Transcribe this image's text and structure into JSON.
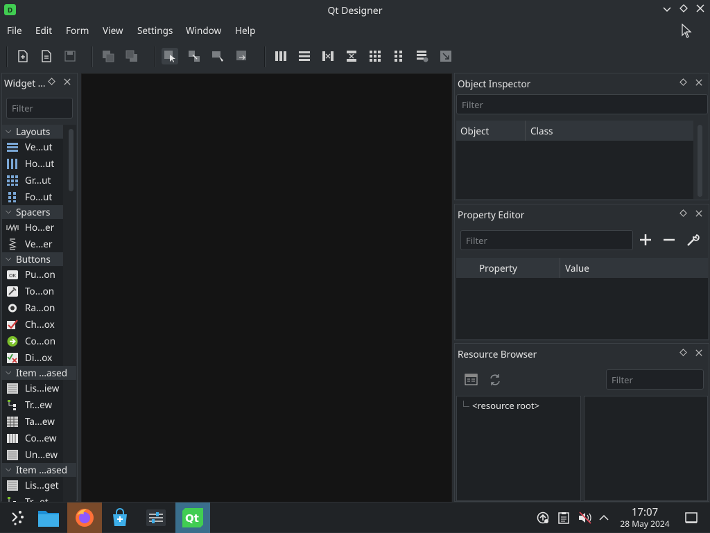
{
  "window": {
    "title": "Qt Designer",
    "icon_letter": "D"
  },
  "menubar": [
    "File",
    "Edit",
    "Form",
    "View",
    "Settings",
    "Window",
    "Help"
  ],
  "widget_box": {
    "title": "Widget ...",
    "filter_placeholder": "Filter",
    "categories": [
      {
        "name": "Layouts",
        "items": [
          "Ve...ut",
          "Ho...ut",
          "Gr...ut",
          "Fo...ut"
        ]
      },
      {
        "name": "Spacers",
        "items": [
          "Ho...er",
          "Ve...er"
        ]
      },
      {
        "name": "Buttons",
        "items": [
          "Pu...on",
          "To...on",
          "Ra...on",
          "Ch...ox",
          "Co...on",
          "Di...ox"
        ]
      },
      {
        "name": "Item ...ased",
        "items": [
          "Lis...iew",
          "Tr...ew",
          "Ta...ew",
          "Co...ew",
          "Un...ew"
        ]
      },
      {
        "name": "Item ...ased",
        "items": [
          "Lis...get",
          "Tr...et"
        ]
      }
    ]
  },
  "object_inspector": {
    "title": "Object Inspector",
    "filter_placeholder": "Filter",
    "columns": [
      "Object",
      "Class"
    ]
  },
  "property_editor": {
    "title": "Property Editor",
    "filter_placeholder": "Filter",
    "columns": [
      "Property",
      "Value"
    ]
  },
  "resource_browser": {
    "title": "Resource Browser",
    "filter_placeholder": "Filter",
    "root": "<resource root>"
  },
  "taskbar": {
    "time": "17:07",
    "date": "28 May 2024"
  },
  "colors": {
    "accent": "#41cd52",
    "firefox_active": "#7a4a2a",
    "qt_active": "#3a6e8c"
  }
}
